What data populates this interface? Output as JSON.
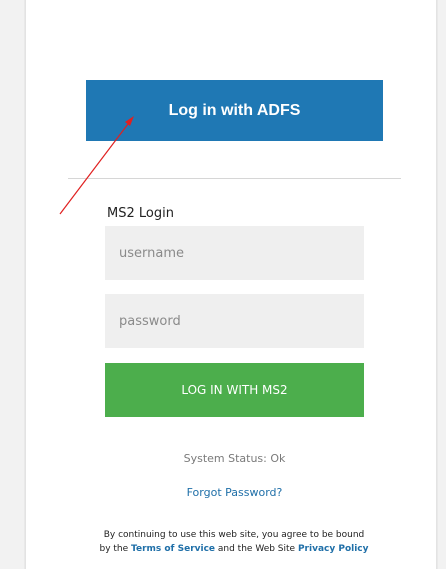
{
  "adfs_button": {
    "label": "Log in with ADFS"
  },
  "ms2": {
    "heading": "MS2 Login",
    "username_placeholder": "username",
    "password_placeholder": "password",
    "login_label": "LOG IN WITH MS2"
  },
  "status": {
    "text": "System Status: Ok"
  },
  "forgot": {
    "label": "Forgot Password?"
  },
  "disclaimer": {
    "line1": "By continuing to use this web site, you agree to be bound",
    "pre_terms": "by the ",
    "terms_link": "Terms of Service",
    "mid": " and the Web Site ",
    "privacy_link": "Privacy Policy"
  },
  "colors": {
    "adfs_blue": "#1f78b4",
    "ms2_green": "#4cae4c",
    "link_blue": "#1f6fa8",
    "annotation_red": "#e02020"
  }
}
